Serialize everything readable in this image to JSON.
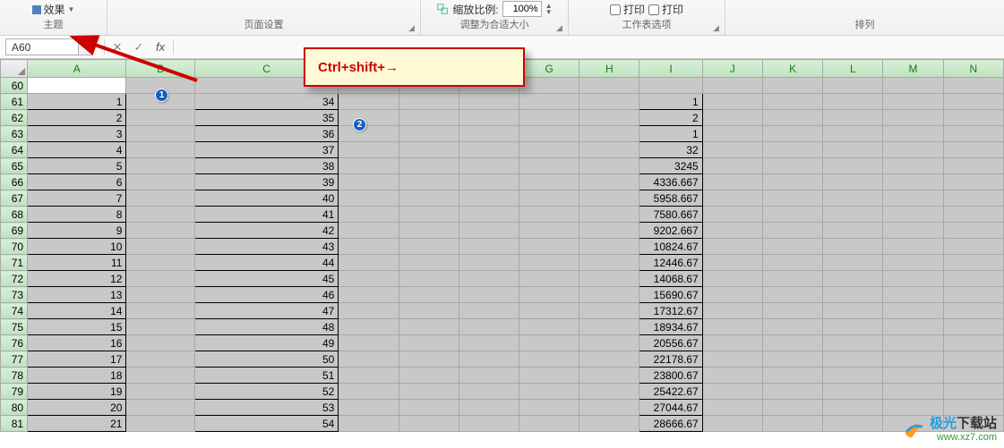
{
  "ribbon": {
    "effects_label": "效果",
    "theme_group": "主题",
    "page_setup_group": "页面设置",
    "zoom_label": "缩放比例:",
    "zoom_value": "100%",
    "fit_group": "调整为合适大小",
    "print1": "打印",
    "print2": "打印",
    "sheet_opts_group": "工作表选项",
    "arrange_group": "排列"
  },
  "formula_bar": {
    "name_box": "A60",
    "cancel": "✕",
    "confirm": "✓",
    "fx": "fx",
    "value": ""
  },
  "callout": {
    "text": "Ctrl+shift+→"
  },
  "badges": {
    "one": "1",
    "two": "2"
  },
  "columns": [
    "A",
    "B",
    "C",
    "D",
    "E",
    "F",
    "G",
    "H",
    "I",
    "J",
    "K",
    "L",
    "M",
    "N"
  ],
  "column_classes": [
    "col-A",
    "col-B",
    "col-C",
    "col-D",
    "col-E",
    "col-F",
    "col-G",
    "col-H",
    "col-I",
    "col-J",
    "col-K",
    "col-L",
    "col-M",
    "col-N"
  ],
  "rows": [
    {
      "n": 60,
      "active": true,
      "A": "",
      "C": "",
      "I": ""
    },
    {
      "n": 61,
      "A": "1",
      "C": "34",
      "I": "1"
    },
    {
      "n": 62,
      "A": "2",
      "C": "35",
      "I": "2"
    },
    {
      "n": 63,
      "A": "3",
      "C": "36",
      "I": "1"
    },
    {
      "n": 64,
      "A": "4",
      "C": "37",
      "I": "32"
    },
    {
      "n": 65,
      "A": "5",
      "C": "38",
      "I": "3245"
    },
    {
      "n": 66,
      "A": "6",
      "C": "39",
      "I": "4336.667"
    },
    {
      "n": 67,
      "A": "7",
      "C": "40",
      "I": "5958.667"
    },
    {
      "n": 68,
      "A": "8",
      "C": "41",
      "I": "7580.667"
    },
    {
      "n": 69,
      "A": "9",
      "C": "42",
      "I": "9202.667"
    },
    {
      "n": 70,
      "A": "10",
      "C": "43",
      "I": "10824.67"
    },
    {
      "n": 71,
      "A": "11",
      "C": "44",
      "I": "12446.67"
    },
    {
      "n": 72,
      "A": "12",
      "C": "45",
      "I": "14068.67"
    },
    {
      "n": 73,
      "A": "13",
      "C": "46",
      "I": "15690.67"
    },
    {
      "n": 74,
      "A": "14",
      "C": "47",
      "I": "17312.67"
    },
    {
      "n": 75,
      "A": "15",
      "C": "48",
      "I": "18934.67"
    },
    {
      "n": 76,
      "A": "16",
      "C": "49",
      "I": "20556.67"
    },
    {
      "n": 77,
      "A": "17",
      "C": "50",
      "I": "22178.67"
    },
    {
      "n": 78,
      "A": "18",
      "C": "51",
      "I": "23800.67"
    },
    {
      "n": 79,
      "A": "19",
      "C": "52",
      "I": "25422.67"
    },
    {
      "n": 80,
      "A": "20",
      "C": "53",
      "I": "27044.67"
    },
    {
      "n": 81,
      "A": "21",
      "C": "54",
      "I": "28666.67"
    }
  ],
  "watermark": {
    "title_prefix": "极光",
    "title_suffix": "下载站",
    "url": "www.xz7.com"
  }
}
